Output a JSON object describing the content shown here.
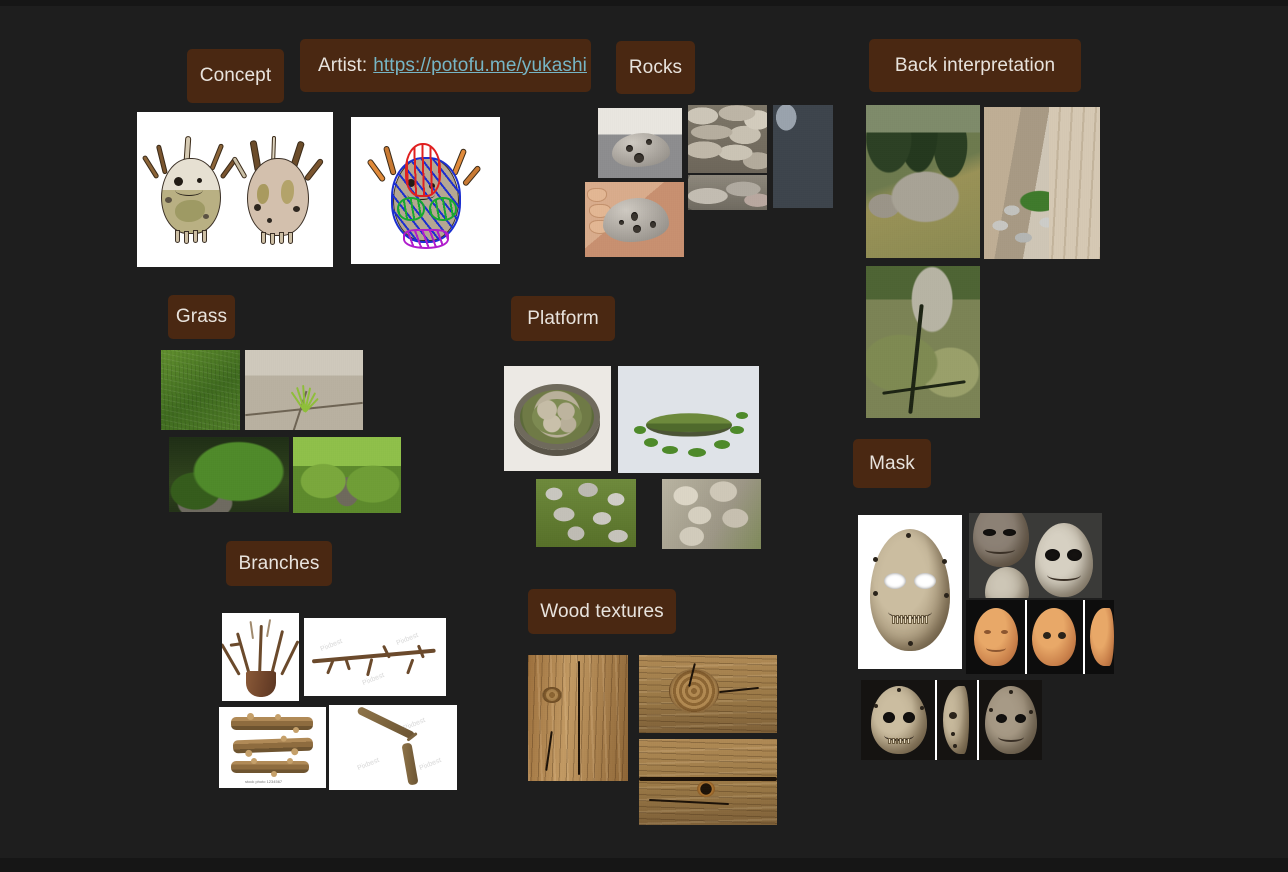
{
  "board": {
    "background_color": "#1e1e1e",
    "label_background_color": "#4a2812",
    "label_text_color": "#e8e3dd",
    "link_color": "#76b5c5"
  },
  "sections": {
    "concept": {
      "label": "Concept",
      "images": [
        {
          "name": "creature-front-and-back-sketch",
          "caption": ""
        },
        {
          "name": "creature-annotated-overlay-sketch",
          "caption": ""
        }
      ]
    },
    "artist": {
      "prefix": "Artist:",
      "link_text": "https://potofu.me/yukashi",
      "link_href": "https://potofu.me/yukashi"
    },
    "rocks": {
      "label": "Rocks",
      "images": [
        {
          "name": "stone-with-holes-on-table"
        },
        {
          "name": "hand-holding-holed-pebble"
        },
        {
          "name": "dry-stone-wall"
        },
        {
          "name": "flat-stacked-stones"
        },
        {
          "name": "cobblestone-pavement"
        }
      ]
    },
    "back_interpretation": {
      "label": "Back interpretation",
      "images": [
        {
          "name": "mountain-boulder-with-pine-trees"
        },
        {
          "name": "pebble-garden-bed-beside-wall"
        },
        {
          "name": "cracked-mossy-boulder"
        }
      ]
    },
    "grass": {
      "label": "Grass",
      "images": [
        {
          "name": "grass-lawn-texture"
        },
        {
          "name": "grass-tuft-in-pavement-crack"
        },
        {
          "name": "moss-covered-rock-in-shade"
        },
        {
          "name": "moss-covered-rocks-on-lawn"
        }
      ]
    },
    "platform": {
      "label": "Platform",
      "images": [
        {
          "name": "mossy-stone-disc-base-photo"
        },
        {
          "name": "mossy-stone-disc-3d-render"
        },
        {
          "name": "rocky-grass-ground-texture"
        },
        {
          "name": "limestone-cliff-texture"
        }
      ]
    },
    "branches": {
      "label": "Branches",
      "images": [
        {
          "name": "dry-branches-in-vase"
        },
        {
          "name": "isolated-tree-branch"
        },
        {
          "name": "cut-log-pieces"
        },
        {
          "name": "bent-wooden-stick"
        }
      ],
      "watermarks": [
        "Pixbest",
        "Pixbest",
        "Pixbest",
        "Pixbest"
      ],
      "thumb_caption": "stock photo  1234567"
    },
    "wood_textures": {
      "label": "Wood textures",
      "images": [
        {
          "name": "vertical-weathered-wood-plank"
        },
        {
          "name": "wood-beam-with-knot"
        },
        {
          "name": "cracked-wood-plank-with-knot"
        }
      ]
    },
    "mask": {
      "label": "Mask",
      "images": [
        {
          "name": "neolithic-stone-mask-main"
        },
        {
          "name": "stone-masks-museum-display"
        },
        {
          "name": "ochre-stone-faces-three-views"
        },
        {
          "name": "stone-mask-three-angles"
        }
      ]
    }
  }
}
